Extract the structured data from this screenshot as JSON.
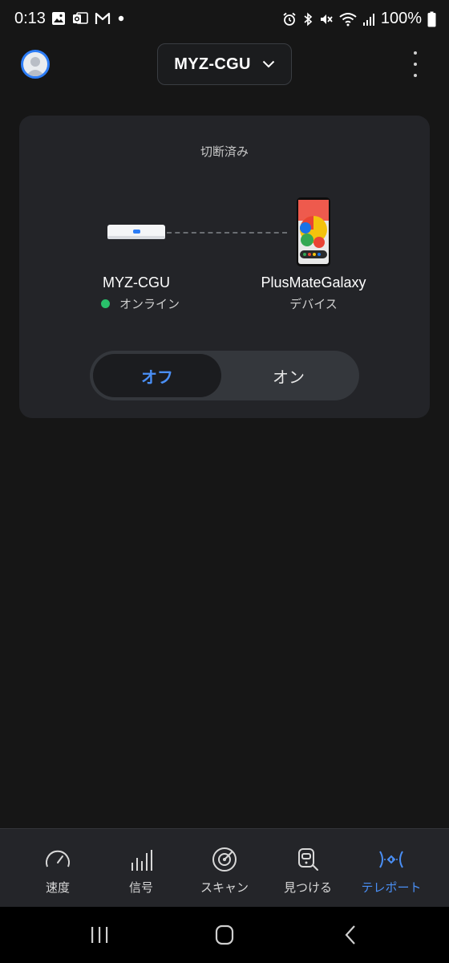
{
  "status_bar": {
    "time": "0:13",
    "battery_text": "100%",
    "left_icons": [
      "gallery-icon",
      "outlook-icon",
      "gmail-icon",
      "dot-icon"
    ],
    "right_icons": [
      "alarm-icon",
      "bluetooth-icon",
      "mute-icon",
      "wifi-icon",
      "signal-icon",
      "battery-icon"
    ]
  },
  "header": {
    "device_name": "MYZ-CGU"
  },
  "card": {
    "status_text": "切断済み",
    "left_device": {
      "name": "MYZ-CGU",
      "status": "オンライン",
      "status_color": "#29c06a"
    },
    "right_device": {
      "name": "PlusMateGalaxy",
      "subtitle": "デバイス"
    },
    "toggle": {
      "off_label": "オフ",
      "on_label": "オン",
      "selected": "off",
      "accent_color": "#4a8ff5"
    }
  },
  "bottom_nav": {
    "items": [
      {
        "label": "速度",
        "icon": "speedometer-icon"
      },
      {
        "label": "信号",
        "icon": "signal-bars-icon"
      },
      {
        "label": "スキャン",
        "icon": "radar-icon"
      },
      {
        "label": "見つける",
        "icon": "find-device-icon"
      },
      {
        "label": "テレポート",
        "icon": "teleport-icon"
      }
    ],
    "active": "テレポート"
  }
}
